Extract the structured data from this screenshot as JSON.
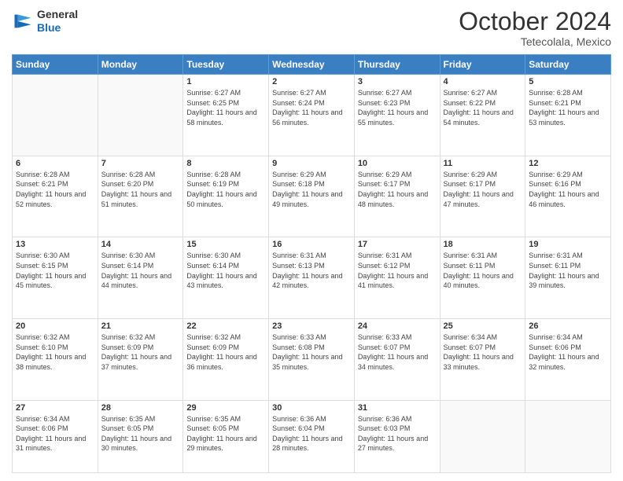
{
  "header": {
    "logo": {
      "line1": "General",
      "line2": "Blue"
    },
    "month": "October 2024",
    "location": "Tetecolala, Mexico"
  },
  "weekdays": [
    "Sunday",
    "Monday",
    "Tuesday",
    "Wednesday",
    "Thursday",
    "Friday",
    "Saturday"
  ],
  "weeks": [
    [
      {
        "day": "",
        "info": ""
      },
      {
        "day": "",
        "info": ""
      },
      {
        "day": "1",
        "sunrise": "6:27 AM",
        "sunset": "6:25 PM",
        "daylight": "11 hours and 58 minutes."
      },
      {
        "day": "2",
        "sunrise": "6:27 AM",
        "sunset": "6:24 PM",
        "daylight": "11 hours and 56 minutes."
      },
      {
        "day": "3",
        "sunrise": "6:27 AM",
        "sunset": "6:23 PM",
        "daylight": "11 hours and 55 minutes."
      },
      {
        "day": "4",
        "sunrise": "6:27 AM",
        "sunset": "6:22 PM",
        "daylight": "11 hours and 54 minutes."
      },
      {
        "day": "5",
        "sunrise": "6:28 AM",
        "sunset": "6:21 PM",
        "daylight": "11 hours and 53 minutes."
      }
    ],
    [
      {
        "day": "6",
        "sunrise": "6:28 AM",
        "sunset": "6:21 PM",
        "daylight": "11 hours and 52 minutes."
      },
      {
        "day": "7",
        "sunrise": "6:28 AM",
        "sunset": "6:20 PM",
        "daylight": "11 hours and 51 minutes."
      },
      {
        "day": "8",
        "sunrise": "6:28 AM",
        "sunset": "6:19 PM",
        "daylight": "11 hours and 50 minutes."
      },
      {
        "day": "9",
        "sunrise": "6:29 AM",
        "sunset": "6:18 PM",
        "daylight": "11 hours and 49 minutes."
      },
      {
        "day": "10",
        "sunrise": "6:29 AM",
        "sunset": "6:17 PM",
        "daylight": "11 hours and 48 minutes."
      },
      {
        "day": "11",
        "sunrise": "6:29 AM",
        "sunset": "6:17 PM",
        "daylight": "11 hours and 47 minutes."
      },
      {
        "day": "12",
        "sunrise": "6:29 AM",
        "sunset": "6:16 PM",
        "daylight": "11 hours and 46 minutes."
      }
    ],
    [
      {
        "day": "13",
        "sunrise": "6:30 AM",
        "sunset": "6:15 PM",
        "daylight": "11 hours and 45 minutes."
      },
      {
        "day": "14",
        "sunrise": "6:30 AM",
        "sunset": "6:14 PM",
        "daylight": "11 hours and 44 minutes."
      },
      {
        "day": "15",
        "sunrise": "6:30 AM",
        "sunset": "6:14 PM",
        "daylight": "11 hours and 43 minutes."
      },
      {
        "day": "16",
        "sunrise": "6:31 AM",
        "sunset": "6:13 PM",
        "daylight": "11 hours and 42 minutes."
      },
      {
        "day": "17",
        "sunrise": "6:31 AM",
        "sunset": "6:12 PM",
        "daylight": "11 hours and 41 minutes."
      },
      {
        "day": "18",
        "sunrise": "6:31 AM",
        "sunset": "6:11 PM",
        "daylight": "11 hours and 40 minutes."
      },
      {
        "day": "19",
        "sunrise": "6:31 AM",
        "sunset": "6:11 PM",
        "daylight": "11 hours and 39 minutes."
      }
    ],
    [
      {
        "day": "20",
        "sunrise": "6:32 AM",
        "sunset": "6:10 PM",
        "daylight": "11 hours and 38 minutes."
      },
      {
        "day": "21",
        "sunrise": "6:32 AM",
        "sunset": "6:09 PM",
        "daylight": "11 hours and 37 minutes."
      },
      {
        "day": "22",
        "sunrise": "6:32 AM",
        "sunset": "6:09 PM",
        "daylight": "11 hours and 36 minutes."
      },
      {
        "day": "23",
        "sunrise": "6:33 AM",
        "sunset": "6:08 PM",
        "daylight": "11 hours and 35 minutes."
      },
      {
        "day": "24",
        "sunrise": "6:33 AM",
        "sunset": "6:07 PM",
        "daylight": "11 hours and 34 minutes."
      },
      {
        "day": "25",
        "sunrise": "6:34 AM",
        "sunset": "6:07 PM",
        "daylight": "11 hours and 33 minutes."
      },
      {
        "day": "26",
        "sunrise": "6:34 AM",
        "sunset": "6:06 PM",
        "daylight": "11 hours and 32 minutes."
      }
    ],
    [
      {
        "day": "27",
        "sunrise": "6:34 AM",
        "sunset": "6:06 PM",
        "daylight": "11 hours and 31 minutes."
      },
      {
        "day": "28",
        "sunrise": "6:35 AM",
        "sunset": "6:05 PM",
        "daylight": "11 hours and 30 minutes."
      },
      {
        "day": "29",
        "sunrise": "6:35 AM",
        "sunset": "6:05 PM",
        "daylight": "11 hours and 29 minutes."
      },
      {
        "day": "30",
        "sunrise": "6:36 AM",
        "sunset": "6:04 PM",
        "daylight": "11 hours and 28 minutes."
      },
      {
        "day": "31",
        "sunrise": "6:36 AM",
        "sunset": "6:03 PM",
        "daylight": "11 hours and 27 minutes."
      },
      {
        "day": "",
        "info": ""
      },
      {
        "day": "",
        "info": ""
      }
    ]
  ],
  "labels": {
    "sunrise_prefix": "Sunrise: ",
    "sunset_prefix": "Sunset: ",
    "daylight_prefix": "Daylight: "
  }
}
